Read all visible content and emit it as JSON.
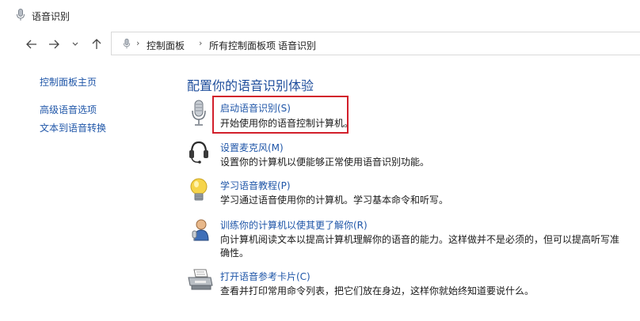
{
  "window": {
    "title": "语音识别",
    "title_icon": "microphone-icon"
  },
  "nav": {
    "back_icon": "arrow-left-icon",
    "forward_icon": "arrow-right-icon",
    "recent_icon": "chevron-down-icon",
    "up_icon": "arrow-up-icon"
  },
  "breadcrumb": [
    "控制面板",
    "所有控制面板项",
    "语音识别"
  ],
  "sidebar": {
    "home": "控制面板主页",
    "links": [
      "高级语音选项",
      "文本到语音转换"
    ]
  },
  "main": {
    "heading": "配置你的语音识别体验",
    "items": [
      {
        "icon": "microphone-icon",
        "link": "启动语音识别(S)",
        "desc": "开始使用你的语音控制计算机。"
      },
      {
        "icon": "headset-icon",
        "link": "设置麦克风(M)",
        "desc": "设置你的计算机以便能够正常使用语音识别功能。"
      },
      {
        "icon": "lightbulb-icon",
        "link": "学习语音教程(P)",
        "desc": "学习通过语音使用你的计算机。学习基本命令和听写。"
      },
      {
        "icon": "user-training-icon",
        "link": "训练你的计算机以使其更了解你(R)",
        "desc": "向计算机阅读文本以提高计算机理解你的语音的能力。这样做并不是必须的，但可以提高听写准确性。"
      },
      {
        "icon": "printer-icon",
        "link": "打开语音参考卡片(C)",
        "desc": "查看并打印常用命令列表，把它们放在身边，这样你就始终知道要说什么。"
      }
    ]
  },
  "colors": {
    "link": "#1f56a8",
    "heading": "#1f4e9c",
    "highlight": "#d21f2b"
  }
}
